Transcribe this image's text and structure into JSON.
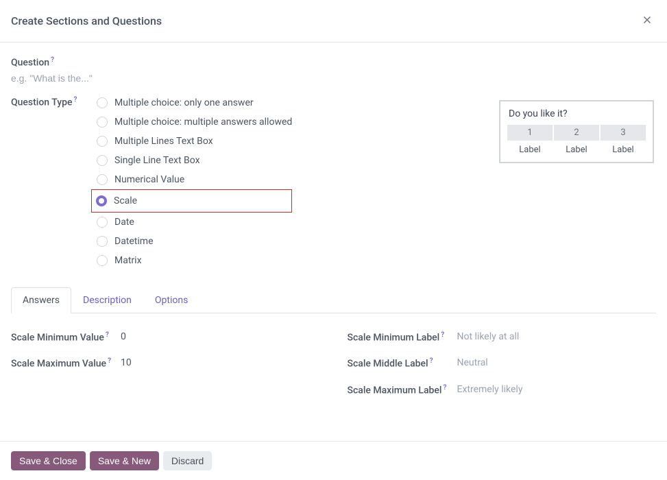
{
  "header": {
    "title": "Create Sections and Questions"
  },
  "question": {
    "label": "Question",
    "placeholder": "e.g. \"What is the...\""
  },
  "questionType": {
    "label": "Question Type",
    "options": [
      {
        "label": "Multiple choice: only one answer",
        "selected": false
      },
      {
        "label": "Multiple choice: multiple answers allowed",
        "selected": false
      },
      {
        "label": "Multiple Lines Text Box",
        "selected": false
      },
      {
        "label": "Single Line Text Box",
        "selected": false
      },
      {
        "label": "Numerical Value",
        "selected": false
      },
      {
        "label": "Scale",
        "selected": true
      },
      {
        "label": "Date",
        "selected": false
      },
      {
        "label": "Datetime",
        "selected": false
      },
      {
        "label": "Matrix",
        "selected": false
      }
    ]
  },
  "preview": {
    "question": "Do you like it?",
    "items": [
      {
        "num": "1",
        "label": "Label"
      },
      {
        "num": "2",
        "label": "Label"
      },
      {
        "num": "3",
        "label": "Label"
      }
    ]
  },
  "tabs": [
    {
      "label": "Answers",
      "active": true
    },
    {
      "label": "Description",
      "active": false
    },
    {
      "label": "Options",
      "active": false
    }
  ],
  "answers": {
    "scaleMinValue": {
      "label": "Scale Minimum Value",
      "value": "0"
    },
    "scaleMaxValue": {
      "label": "Scale Maximum Value",
      "value": "10"
    },
    "scaleMinLabel": {
      "label": "Scale Minimum Label",
      "placeholder": "Not likely at all"
    },
    "scaleMidLabel": {
      "label": "Scale Middle Label",
      "placeholder": "Neutral"
    },
    "scaleMaxLabel": {
      "label": "Scale Maximum Label",
      "placeholder": "Extremely likely"
    }
  },
  "footer": {
    "saveClose": "Save & Close",
    "saveNew": "Save & New",
    "discard": "Discard"
  },
  "help": "?"
}
